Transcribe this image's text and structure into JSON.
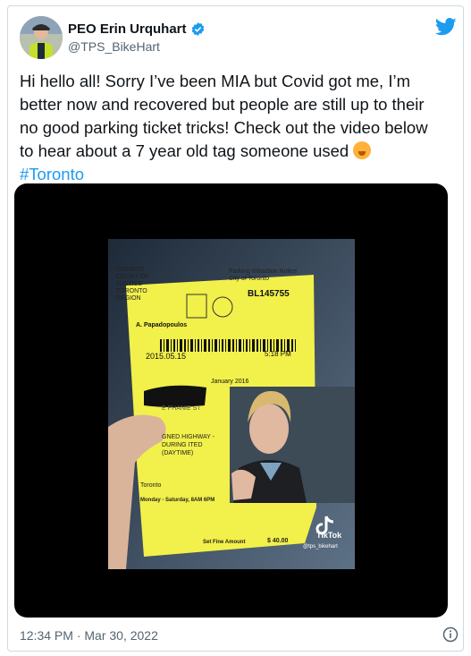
{
  "author": {
    "display_name": "PEO Erin Urquhart",
    "handle": "@TPS_BikeHart"
  },
  "tweet": {
    "text_main": "Hi hello all! Sorry I’ve been MIA but Covid got me, I’m better now and recovered but people are still up to their no good parking ticket tricks! Check out the video below to hear about a 7 year old tag someone used ",
    "hashtag": "#Toronto",
    "timestamp": "12:34 PM · Mar 30, 2022"
  },
  "video": {
    "ticket_header_left": "ONTARIO COURT OF JUSTICE TORONTO REGION",
    "ticket_title": "Parking Infraction Notice City of Toronto",
    "ticket_number": "BL145755",
    "officer": "A. Papadopoulos",
    "date": "2015.05.15",
    "time": "5:18 PM",
    "plate_expiry": "January 2016",
    "street": "E PHANIE ST",
    "offence": "GNED HIGHWAY - DURING ITED (DAYTIME)",
    "municipality": "Toronto",
    "hours": "Monday - Saturday, 8AM 6PM",
    "fine_label": "Set Fine Amount",
    "fine_amount": "$ 40.00",
    "tiktok_brand": "TikTok",
    "tiktok_handle": "@tps_bikehart"
  },
  "colors": {
    "link": "#1d9bf0",
    "ticket": "#f2f04a",
    "secondary_text": "#536471"
  },
  "icons": [
    "verified-badge-icon",
    "twitter-bird-icon",
    "info-icon",
    "tiktok-icon",
    "face-with-hand-over-mouth-emoji"
  ]
}
